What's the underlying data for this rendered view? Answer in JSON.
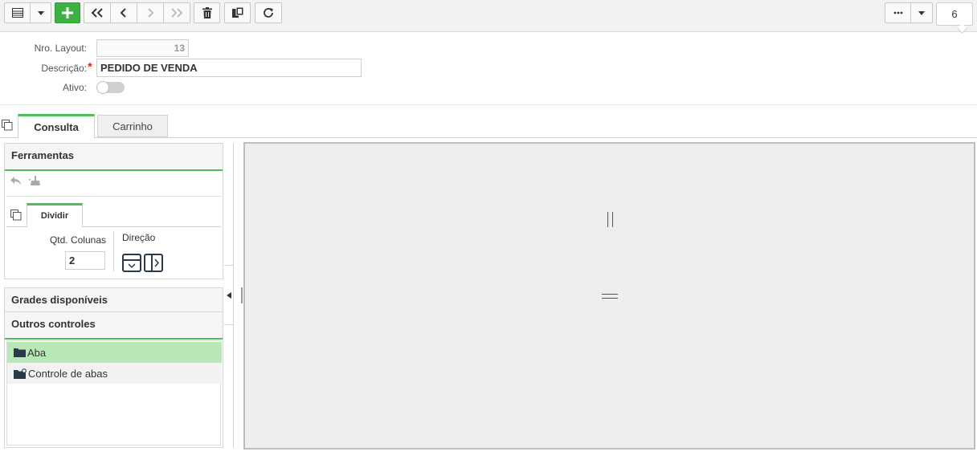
{
  "toolbar": {
    "buttons": [
      {
        "name": "list-view-button",
        "icon": "list-icon"
      },
      {
        "name": "list-view-dropdown",
        "icon": "caret-down-icon"
      },
      {
        "name": "add-button",
        "icon": "plus-icon"
      },
      {
        "name": "first-record-button",
        "icon": "double-chevron-left-icon"
      },
      {
        "name": "previous-record-button",
        "icon": "chevron-left-icon"
      },
      {
        "name": "next-record-button",
        "icon": "chevron-right-icon"
      },
      {
        "name": "last-record-button",
        "icon": "double-chevron-right-icon"
      },
      {
        "name": "delete-button",
        "icon": "trash-icon"
      },
      {
        "name": "copy-button",
        "icon": "copy-icon"
      },
      {
        "name": "refresh-button",
        "icon": "refresh-icon"
      },
      {
        "name": "more-options-button",
        "icon": "ellipsis-icon"
      },
      {
        "name": "more-options-dropdown",
        "icon": "caret-down-icon"
      }
    ],
    "page_count": "6"
  },
  "form": {
    "layout_number_label": "Nro. Layout:",
    "layout_number_value": "13",
    "description_label": "Descrição:",
    "description_value": "PEDIDO DE VENDA",
    "active_label": "Ativo:",
    "active": false
  },
  "tabs": [
    {
      "label": "Consulta",
      "active": true
    },
    {
      "label": "Carrinho",
      "active": false
    }
  ],
  "tools_panel": {
    "title": "Ferramentas",
    "subtab_label": "Dividir",
    "columns_label": "Qtd. Colunas",
    "columns_value": "2",
    "direction_label": "Direção"
  },
  "available_grids_title": "Grades disponíveis",
  "other_controls": {
    "title": "Outros controles",
    "items": [
      {
        "label": "Aba",
        "icon": "folder-icon",
        "selected": true
      },
      {
        "label": "Controle de abas",
        "icon": "folder-gear-icon",
        "selected": false
      }
    ]
  },
  "colors": {
    "accent_green": "#4cbf5a",
    "add_button_green": "#3cb043",
    "selected_row": "#b8e8b8",
    "required_star": "#d9302a"
  }
}
